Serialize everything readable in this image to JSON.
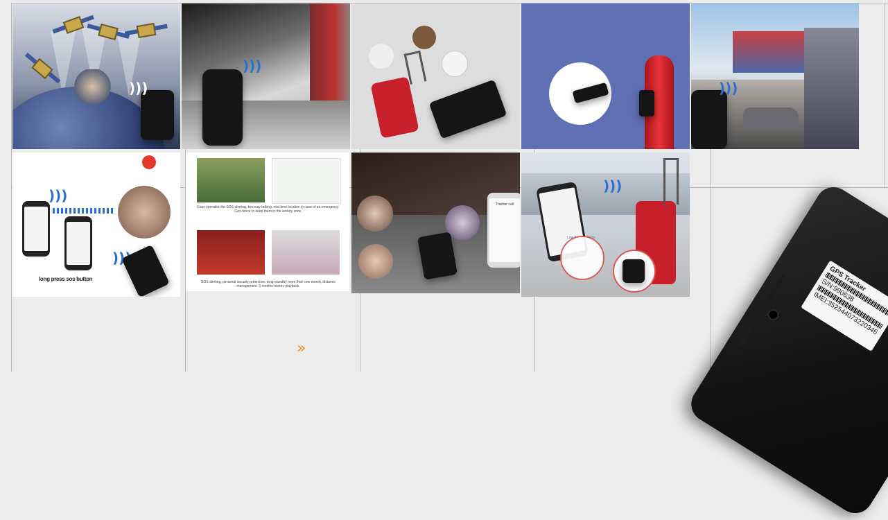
{
  "gallery": {
    "images": [
      {
        "label": "satellite positioning"
      },
      {
        "label": "truck tracking"
      },
      {
        "label": "luggage tracking"
      },
      {
        "label": "fire extinguisher tracking"
      },
      {
        "label": "vehicle and motorcycle tracking"
      },
      {
        "label": "sos call"
      },
      {
        "label": "elderly and child safety"
      },
      {
        "label": "voice call tracking"
      },
      {
        "label": "travel luggage alerts"
      }
    ],
    "sos_caption": "long press sos button",
    "panel7_text_top": "Easy operation for SOS alerting, two-way talking, real-time location in case of an emergency. Geo-fence to keep them in the activity zone.",
    "panel7_text_bottom": "SOS alerting, personal security protection, long-standby more than one month, distance management. 6 months history playback.",
    "phone_call_title": "Tracker call",
    "alert_text": "Low battery alarm"
  },
  "tracker": {
    "label_title": "GPS Tracker",
    "sn": "S/N:990638",
    "imei": "IMEI:352544073220346"
  },
  "pager": {
    "next_label": "»"
  },
  "colors": {
    "accent": "#f08a1c",
    "grid": "#b9b9b9",
    "background": "#ececec"
  }
}
